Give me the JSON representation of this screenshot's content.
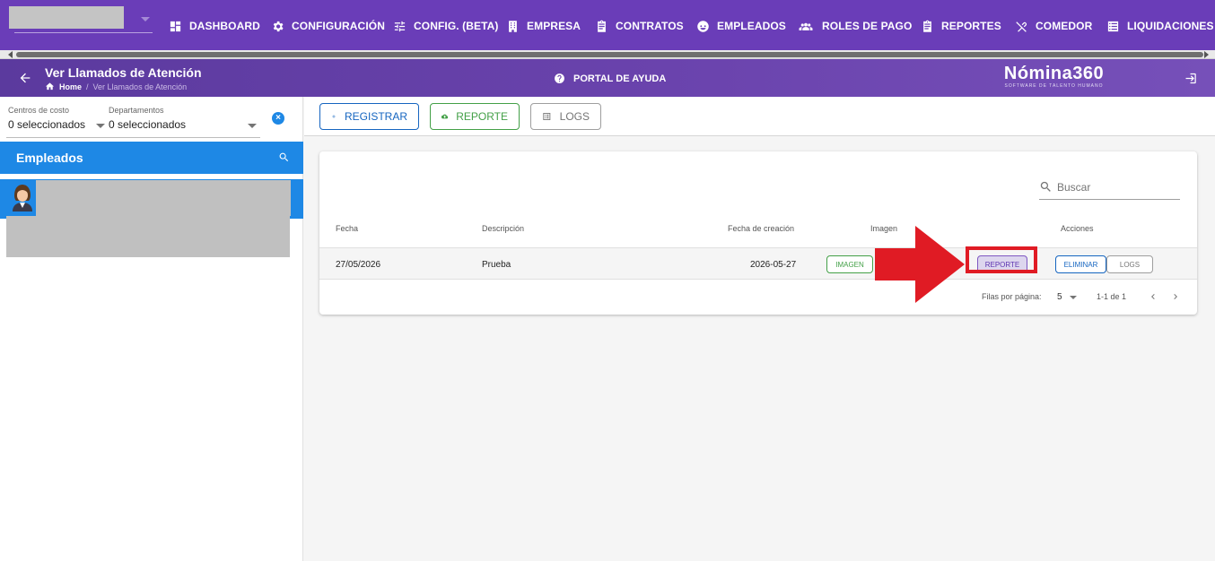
{
  "nav": {
    "items": [
      {
        "label": "DASHBOARD",
        "icon": "dashboard-icon"
      },
      {
        "label": "CONFIGURACIÓN",
        "icon": "gear-icon"
      },
      {
        "label": "CONFIG. (BETA)",
        "icon": "tune-icon"
      },
      {
        "label": "EMPRESA",
        "icon": "building-icon"
      },
      {
        "label": "CONTRATOS",
        "icon": "clipboard-icon"
      },
      {
        "label": "EMPLEADOS",
        "icon": "face-icon"
      },
      {
        "label": "ROLES DE PAGO",
        "icon": "group-icon"
      },
      {
        "label": "REPORTES",
        "icon": "clipboard-icon"
      },
      {
        "label": "COMEDOR",
        "icon": "utensils-icon"
      },
      {
        "label": "LIQUIDACIONES",
        "icon": "list-icon"
      }
    ]
  },
  "header": {
    "title": "Ver Llamados de Atención",
    "breadcrumb_home": "Home",
    "breadcrumb_current": "Ver Llamados de Atención",
    "help_label": "PORTAL DE AYUDA",
    "brand_name": "Nómina360",
    "brand_tagline": "SOFTWARE DE TALENTO HUMANO"
  },
  "filters": {
    "cost_centers_label": "Centros de costo",
    "cost_centers_value": "0 seleccionados",
    "departments_label": "Departamentos",
    "departments_value": "0 seleccionados"
  },
  "employees": {
    "title": "Empleados"
  },
  "toolbar": {
    "register_label": "REGISTRAR",
    "report_label": "REPORTE",
    "logs_label": "LOGS"
  },
  "table": {
    "search_placeholder": "Buscar",
    "headers": {
      "date": "Fecha",
      "description": "Descripción",
      "created": "Fecha de creación",
      "image": "Imagen",
      "actions": "Acciones"
    },
    "rows": [
      {
        "date": "27/05/2026",
        "description": "Prueba",
        "created": "2026-05-27",
        "image_label": "IMAGEN",
        "report_label": "REPORTE",
        "delete_label": "ELIMINAR",
        "logs_label": "LOGS"
      }
    ],
    "rows_per_page_label": "Filas por página:",
    "rows_per_page_value": "5",
    "range_text": "1-1 de 1"
  },
  "colors": {
    "nav_bg": "#6a3db8",
    "primary_blue": "#1e88e5",
    "success_green": "#43a047",
    "highlight_red": "#e01b24"
  }
}
